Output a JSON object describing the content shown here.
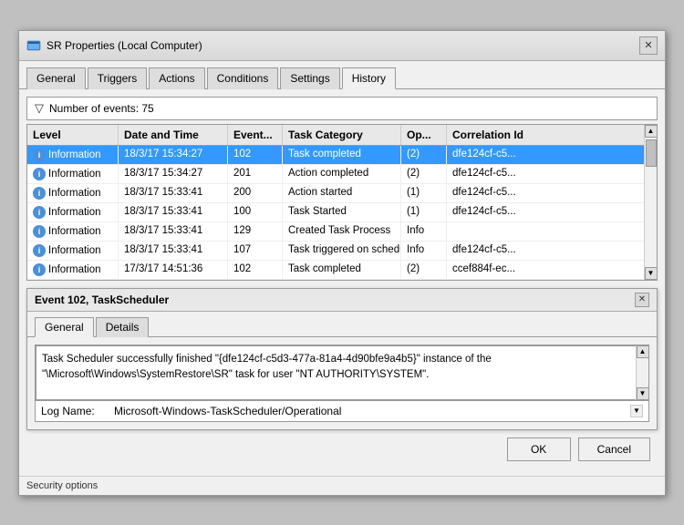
{
  "window": {
    "title": "SR Properties (Local Computer)",
    "close_label": "✕"
  },
  "tabs": [
    {
      "label": "General"
    },
    {
      "label": "Triggers"
    },
    {
      "label": "Actions"
    },
    {
      "label": "Conditions"
    },
    {
      "label": "Settings"
    },
    {
      "label": "History"
    }
  ],
  "active_tab": "History",
  "filter": {
    "text": "Number of events: 75"
  },
  "table": {
    "headers": [
      "Level",
      "Date and Time",
      "Event...",
      "Task Category",
      "Op...",
      "Correlation Id"
    ],
    "rows": [
      {
        "level": "Information",
        "date": "18/3/17 15:34:27",
        "event": "102",
        "category": "Task completed",
        "op": "(2)",
        "correlation": "dfe124cf-c5...",
        "selected": true
      },
      {
        "level": "Information",
        "date": "18/3/17 15:34:27",
        "event": "201",
        "category": "Action completed",
        "op": "(2)",
        "correlation": "dfe124cf-c5...",
        "selected": false
      },
      {
        "level": "Information",
        "date": "18/3/17 15:33:41",
        "event": "200",
        "category": "Action started",
        "op": "(1)",
        "correlation": "dfe124cf-c5...",
        "selected": false
      },
      {
        "level": "Information",
        "date": "18/3/17 15:33:41",
        "event": "100",
        "category": "Task Started",
        "op": "(1)",
        "correlation": "dfe124cf-c5...",
        "selected": false
      },
      {
        "level": "Information",
        "date": "18/3/17 15:33:41",
        "event": "129",
        "category": "Created Task Process",
        "op": "Info",
        "correlation": "",
        "selected": false
      },
      {
        "level": "Information",
        "date": "18/3/17 15:33:41",
        "event": "107",
        "category": "Task triggered on scheduler",
        "op": "Info",
        "correlation": "dfe124cf-c5...",
        "selected": false
      },
      {
        "level": "Information",
        "date": "17/3/17 14:51:36",
        "event": "102",
        "category": "Task completed",
        "op": "(2)",
        "correlation": "ccef884f-ec...",
        "selected": false
      }
    ]
  },
  "sub_window": {
    "title": "Event 102, TaskScheduler",
    "close_label": "✕",
    "tabs": [
      "General",
      "Details"
    ],
    "active_tab": "General",
    "description": "Task Scheduler successfully finished \"{dfe124cf-c5d3-477a-81a4-4d90bfe9a4b5}\" instance of the \"\\Microsoft\\Windows\\SystemRestore\\SR\" task for user \"NT AUTHORITY\\SYSTEM\".",
    "log_name_label": "Log Name:",
    "log_name_value": "Microsoft-Windows-TaskScheduler/Operational"
  },
  "buttons": {
    "ok": "OK",
    "cancel": "Cancel"
  },
  "bottom_strip": {
    "text": "Security options"
  }
}
